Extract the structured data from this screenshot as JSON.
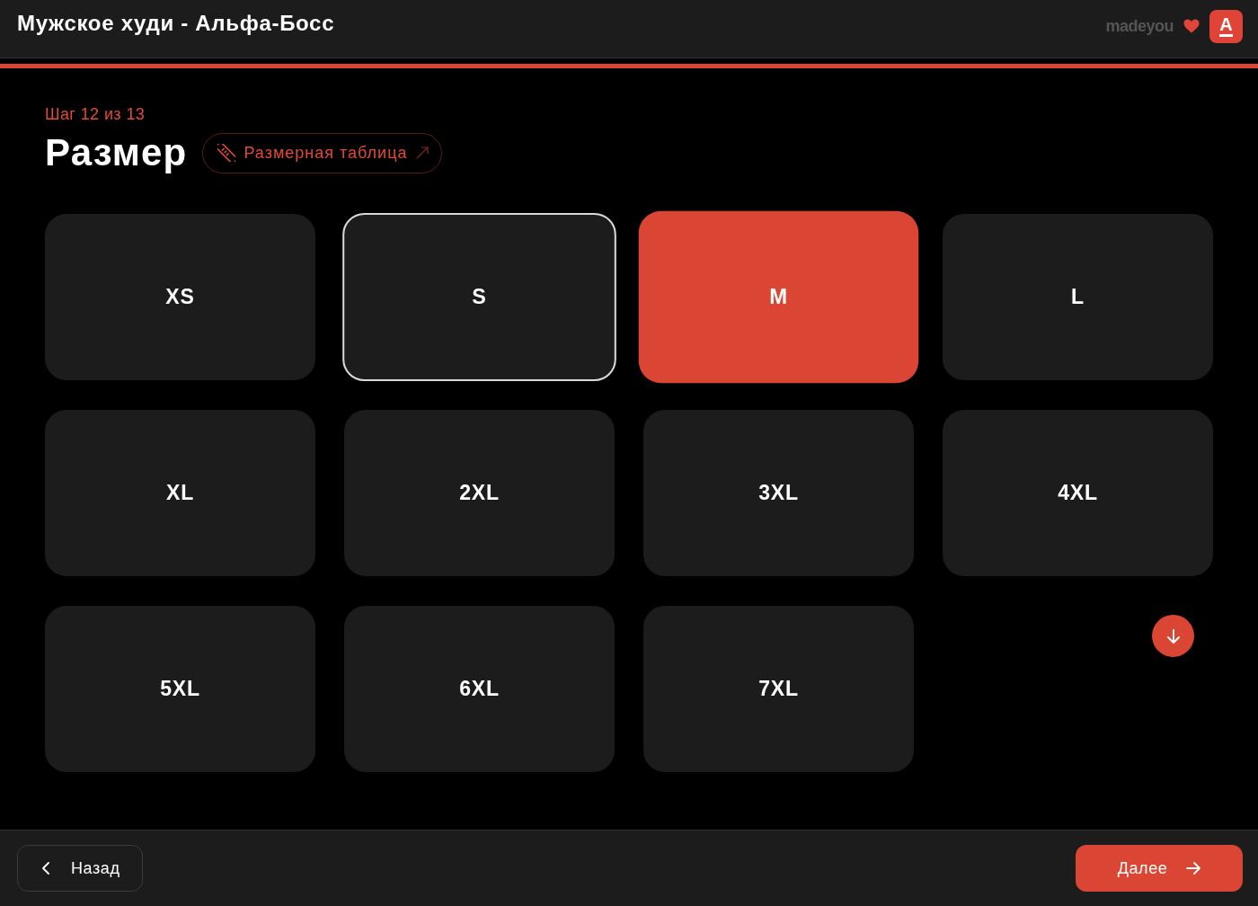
{
  "header": {
    "title": "Мужское худи - Альфа-Босс",
    "partner_logo": "madeyou",
    "brand_logo": "А"
  },
  "step": "Шаг 12 из 13",
  "heading": "Размер",
  "size_chart_link": {
    "label": "Размерная таблица"
  },
  "sizes": [
    {
      "label": "XS",
      "selected": false,
      "hovered": false
    },
    {
      "label": "S",
      "selected": false,
      "hovered": true
    },
    {
      "label": "M",
      "selected": true,
      "hovered": false
    },
    {
      "label": "L",
      "selected": false,
      "hovered": false
    },
    {
      "label": "XL",
      "selected": false,
      "hovered": false
    },
    {
      "label": "2XL",
      "selected": false,
      "hovered": false
    },
    {
      "label": "3XL",
      "selected": false,
      "hovered": false
    },
    {
      "label": "4XL",
      "selected": false,
      "hovered": false
    },
    {
      "label": "5XL",
      "selected": false,
      "hovered": false
    },
    {
      "label": "6XL",
      "selected": false,
      "hovered": false
    },
    {
      "label": "7XL",
      "selected": false,
      "hovered": false
    }
  ],
  "footer": {
    "back": {
      "label": "Назад"
    },
    "next": {
      "label": "Далее"
    }
  }
}
